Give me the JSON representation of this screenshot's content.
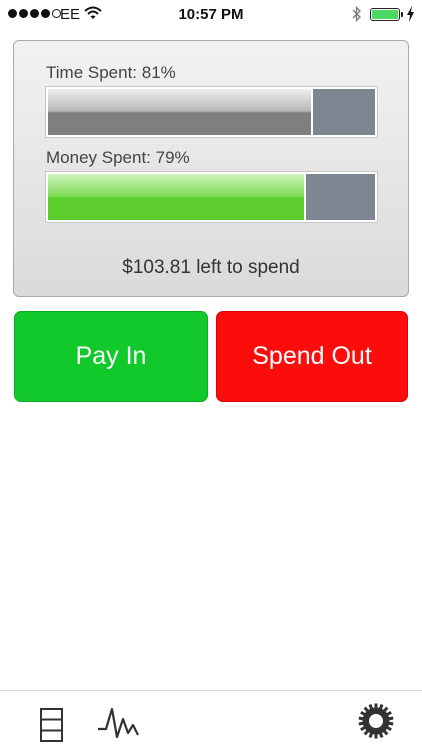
{
  "status_bar": {
    "carrier": "EE",
    "time": "10:57 PM",
    "signal_bars_filled": 4,
    "signal_bars_total": 5,
    "battery_level": 1.0,
    "icons": [
      "wifi-icon",
      "bluetooth-icon",
      "battery-icon",
      "charging-icon"
    ]
  },
  "summary": {
    "time_label": "Time Spent: 81%",
    "time_fraction": 0.81,
    "money_label": "Money Spent: 79%",
    "money_fraction": 0.79,
    "left_to_spend": "$103.81 left to spend"
  },
  "actions": {
    "pay_in": "Pay In",
    "spend_out": "Spend Out"
  },
  "tab_bar": {
    "items": [
      {
        "name": "list",
        "icon": "list-icon"
      },
      {
        "name": "graph",
        "icon": "graph-icon"
      },
      {
        "name": "settings",
        "icon": "gear-icon"
      }
    ]
  },
  "colors": {
    "pay_in": "#11c92b",
    "spend_out": "#fd0c0c",
    "money_fill": "#5ccd2c",
    "time_fill": "#7f7f7f",
    "remaining": "#7e8791"
  }
}
